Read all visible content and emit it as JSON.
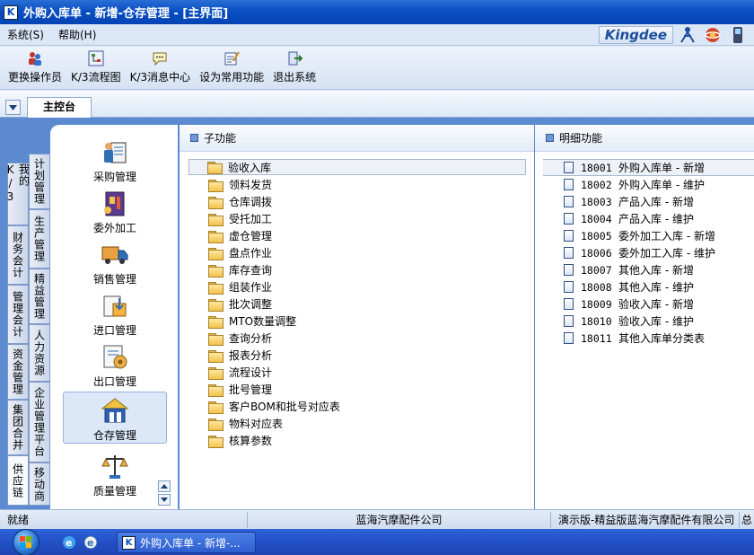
{
  "window": {
    "title": "外购入库单 - 新增-仓存管理 - [主界面]",
    "icon_letter": "K"
  },
  "menu": {
    "items": [
      "系统(S)",
      "帮助(H)"
    ]
  },
  "brand": {
    "logo": "Kingdee"
  },
  "toolbar": {
    "items": [
      {
        "label": "更换操作员",
        "icon": "user-switch-icon"
      },
      {
        "label": "K/3流程图",
        "icon": "flowchart-icon"
      },
      {
        "label": "K/3消息中心",
        "icon": "message-center-icon"
      },
      {
        "label": "设为常用功能",
        "icon": "favorite-edit-icon"
      },
      {
        "label": "退出系统",
        "icon": "exit-icon"
      }
    ]
  },
  "tabs": {
    "main": "主控台"
  },
  "vertical_tabs": {
    "left": [
      "我的K/3",
      "财务会计",
      "管理会计",
      "资金管理",
      "集团合并",
      "供应链"
    ],
    "right": [
      "计划管理",
      "生产管理",
      "精益管理",
      "人力资源",
      "企业管理平台",
      "移动商"
    ]
  },
  "modules": [
    "采购管理",
    "委外加工",
    "销售管理",
    "进口管理",
    "出口管理",
    "仓存管理",
    "质量管理"
  ],
  "selected_module": "仓存管理",
  "sub_panel": {
    "title": "子功能",
    "items": [
      "验收入库",
      "领料发货",
      "仓库调拨",
      "受托加工",
      "虚仓管理",
      "盘点作业",
      "库存查询",
      "组装作业",
      "批次调整",
      "MTO数量调整",
      "查询分析",
      "报表分析",
      "流程设计",
      "批号管理",
      "客户BOM和批号对应表",
      "物料对应表",
      "核算参数"
    ],
    "selected": "验收入库"
  },
  "detail_panel": {
    "title": "明细功能",
    "items": [
      {
        "code": "18001",
        "name": "外购入库单 - 新增"
      },
      {
        "code": "18002",
        "name": "外购入库单 - 维护"
      },
      {
        "code": "18003",
        "name": "产品入库 - 新增"
      },
      {
        "code": "18004",
        "name": "产品入库 - 维护"
      },
      {
        "code": "18005",
        "name": "委外加工入库 - 新增"
      },
      {
        "code": "18006",
        "name": "委外加工入库 - 维护"
      },
      {
        "code": "18007",
        "name": "其他入库 - 新增"
      },
      {
        "code": "18008",
        "name": "其他入库 - 维护"
      },
      {
        "code": "18009",
        "name": "验收入库 - 新增"
      },
      {
        "code": "18010",
        "name": "验收入库 - 维护"
      },
      {
        "code": "18011",
        "name": "其他入库单分类表"
      }
    ]
  },
  "status": {
    "ready": "就绪",
    "company": "蓝海汽摩配件公司",
    "edition": "演示版-精益版蓝海汽摩配件有限公司",
    "tail": "总"
  },
  "taskbar": {
    "task_label": "外购入库单 - 新增-..."
  }
}
